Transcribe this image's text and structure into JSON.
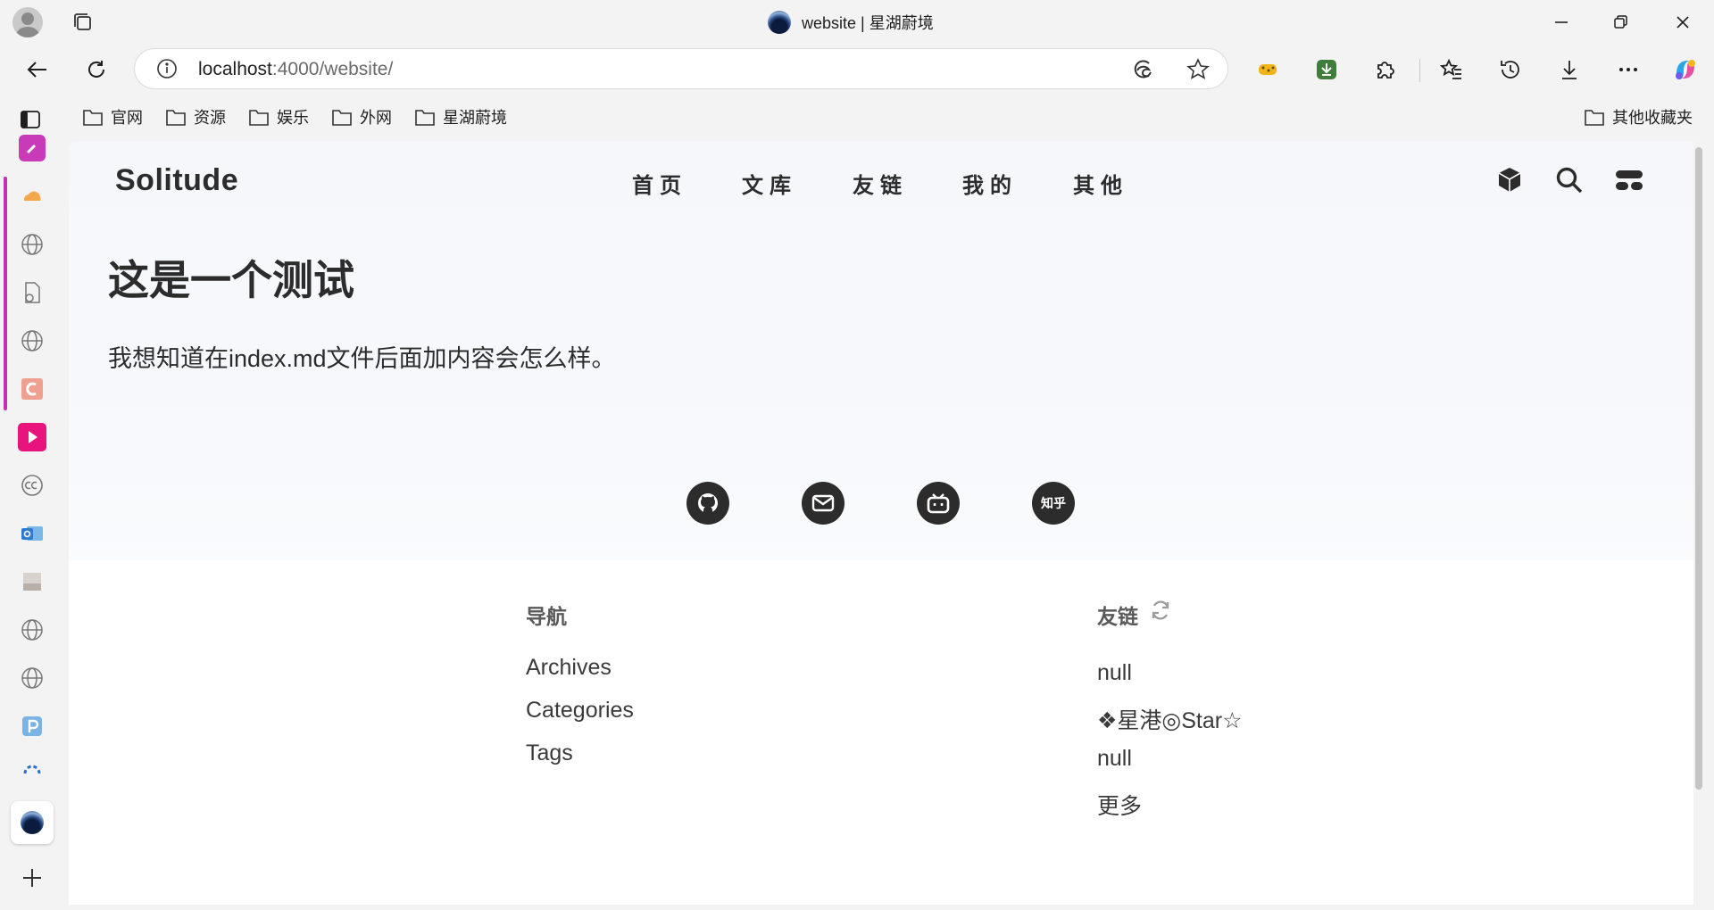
{
  "window": {
    "tab_title": "website | 星湖蔚境"
  },
  "address_bar": {
    "url_host": "localhost",
    "url_path": ":4000/website/"
  },
  "bookmarks": [
    {
      "label": "官网"
    },
    {
      "label": "资源"
    },
    {
      "label": "娱乐"
    },
    {
      "label": "外网"
    },
    {
      "label": "星湖蔚境"
    }
  ],
  "bookmarks_other": "其他收藏夹",
  "site": {
    "brand": "Solitude",
    "nav": [
      "首页",
      "文库",
      "友链",
      "我的",
      "其他"
    ]
  },
  "post": {
    "title": "这是一个测试",
    "body": "我想知道在index.md文件后面加内容会怎么样。"
  },
  "social": {
    "zhihu_label": "知乎"
  },
  "footer": {
    "nav_heading": "导航",
    "nav_links": [
      "Archives",
      "Categories",
      "Tags"
    ],
    "friends_heading": "友链",
    "friends_links": [
      "null",
      "❖星港◎Star☆",
      "null",
      "更多"
    ]
  }
}
